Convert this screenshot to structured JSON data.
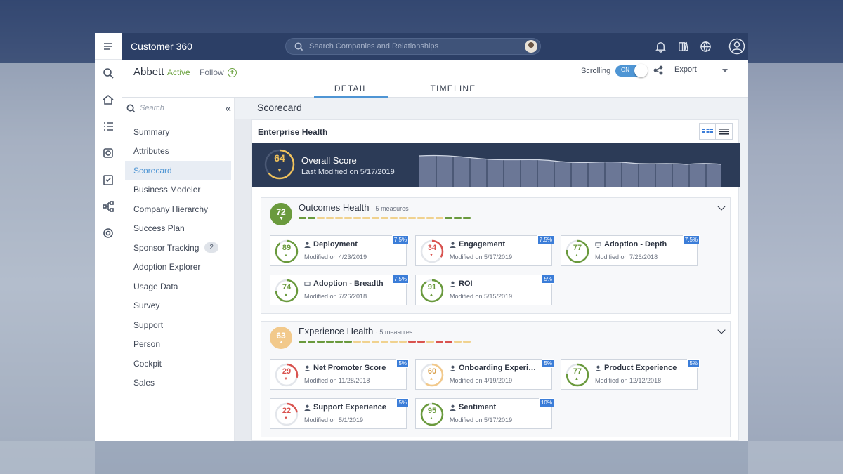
{
  "app": {
    "title": "Customer 360",
    "search_placeholder": "Search Companies and Relationships"
  },
  "header": {
    "company": "Abbett",
    "status": "Active",
    "follow": "Follow",
    "tabs": [
      "DETAIL",
      "TIMELINE"
    ],
    "scrolling_label": "Scrolling",
    "toggle": "ON",
    "export": "Export"
  },
  "sidebar": {
    "search_placeholder": "Search",
    "items": [
      {
        "label": "Summary"
      },
      {
        "label": "Attributes"
      },
      {
        "label": "Scorecard",
        "active": true
      },
      {
        "label": "Business Modeler"
      },
      {
        "label": "Company Hierarchy"
      },
      {
        "label": "Success Plan"
      },
      {
        "label": "Sponsor Tracking",
        "badge": "2"
      },
      {
        "label": "Adoption Explorer"
      },
      {
        "label": "Usage Data"
      },
      {
        "label": "Survey"
      },
      {
        "label": "Support"
      },
      {
        "label": "Person"
      },
      {
        "label": "Cockpit"
      },
      {
        "label": "Sales"
      }
    ]
  },
  "scorecard": {
    "page_title": "Scorecard",
    "card_title": "Enterprise Health",
    "overall": {
      "score": "64",
      "title": "Overall Score",
      "modified": "Last Modified on 5/17/2019",
      "color": "#f0c25b"
    },
    "sections": [
      {
        "title": "Outcomes Health",
        "measures_count": "· 5 measures",
        "score": "72",
        "color": "#6a9a3d",
        "dash_colors": [
          "#6a9a3d",
          "#6a9a3d",
          "#f0d28f",
          "#f0d28f",
          "#f0d28f",
          "#f0d28f",
          "#f0d28f",
          "#f0d28f",
          "#f0d28f",
          "#f0d28f",
          "#f0d28f",
          "#f0d28f",
          "#f0d28f",
          "#f0d28f",
          "#f0d28f",
          "#f0d28f",
          "#6a9a3d",
          "#6a9a3d",
          "#6a9a3d"
        ],
        "measures": [
          {
            "score": "89",
            "name": "Deployment",
            "modified": "Modified on 4/23/2019",
            "weight": "7.5%",
            "color": "#6a9a3d",
            "icon": "person-icon"
          },
          {
            "score": "34",
            "name": "Engagement",
            "modified": "Modified on 5/17/2019",
            "weight": "7.5%",
            "color": "#d9534f",
            "icon": "person-icon"
          },
          {
            "score": "77",
            "name": "Adoption - Depth",
            "modified": "Modified on 7/26/2018",
            "weight": "7.5%",
            "color": "#6a9a3d",
            "icon": "monitor-icon"
          },
          {
            "score": "74",
            "name": "Adoption - Breadth",
            "modified": "Modified on 7/26/2018",
            "weight": "7.5%",
            "color": "#6a9a3d",
            "icon": "monitor-icon"
          },
          {
            "score": "91",
            "name": "ROI",
            "modified": "Modified on 5/15/2019",
            "weight": "5%",
            "color": "#6a9a3d",
            "icon": "person-icon"
          }
        ]
      },
      {
        "title": "Experience Health",
        "measures_count": "· 5 measures",
        "score": "63",
        "color": "#f2c98b",
        "dash_colors": [
          "#6a9a3d",
          "#6a9a3d",
          "#6a9a3d",
          "#6a9a3d",
          "#6a9a3d",
          "#6a9a3d",
          "#f0d28f",
          "#f0d28f",
          "#f0d28f",
          "#f0d28f",
          "#f0d28f",
          "#f0d28f",
          "#d9534f",
          "#d9534f",
          "#f0d28f",
          "#d9534f",
          "#d9534f",
          "#f0d28f",
          "#f0d28f"
        ],
        "measures": [
          {
            "score": "29",
            "name": "Net Promoter Score",
            "modified": "Modified on 11/28/2018",
            "weight": "5%",
            "color": "#d9534f",
            "icon": "person-icon"
          },
          {
            "score": "60",
            "name": "Onboarding Experience",
            "modified": "Modified on 4/19/2019",
            "weight": "5%",
            "color": "#f2c98b",
            "icon": "person-icon"
          },
          {
            "score": "77",
            "name": "Product Experience",
            "modified": "Modified on 12/12/2018",
            "weight": "5%",
            "color": "#6a9a3d",
            "icon": "person-icon"
          },
          {
            "score": "22",
            "name": "Support Experience",
            "modified": "Modified on 5/1/2019",
            "weight": "5%",
            "color": "#d9534f",
            "icon": "person-icon"
          },
          {
            "score": "95",
            "name": "Sentiment",
            "modified": "Modified on 5/17/2019",
            "weight": "10%",
            "color": "#6a9a3d",
            "icon": "person-icon"
          }
        ]
      }
    ]
  }
}
